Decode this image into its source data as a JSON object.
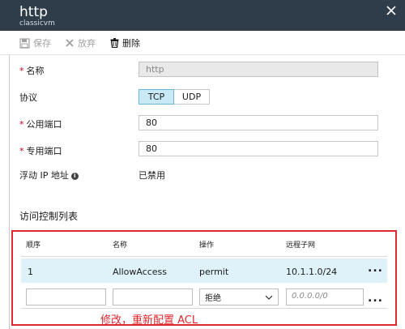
{
  "header": {
    "title": "http",
    "subtitle": "classicvm"
  },
  "toolbar": {
    "save_label": "保存",
    "discard_label": "放弃",
    "delete_label": "删除"
  },
  "form": {
    "name": {
      "label": "名称",
      "value": "http"
    },
    "protocol": {
      "label": "协议",
      "options": [
        "TCP",
        "UDP"
      ],
      "selected": "TCP"
    },
    "public_port": {
      "label": "公用端口",
      "value": "80"
    },
    "private_port": {
      "label": "专用端口",
      "value": "80"
    },
    "floating_ip": {
      "label": "浮动 IP 地址",
      "value": "已禁用"
    }
  },
  "acl": {
    "section_title": "访问控制列表",
    "columns": [
      "顺序",
      "名称",
      "操作",
      "远程子网"
    ],
    "rows": [
      {
        "order": "1",
        "name": "AllowAccess",
        "action": "permit",
        "subnet": "10.1.1.0/24"
      }
    ],
    "new_row": {
      "order": "",
      "name": "",
      "action": "拒绝",
      "subnet_placeholder": "0.0.0.0/0"
    },
    "more_label": "...",
    "annotation": "修改，重新配置 ACL"
  },
  "colors": {
    "header_bg": "#2f3d4b",
    "accent_selected": "#c9e9f6",
    "annotation_red": "#e0282f",
    "required_star": "#d0021b"
  }
}
